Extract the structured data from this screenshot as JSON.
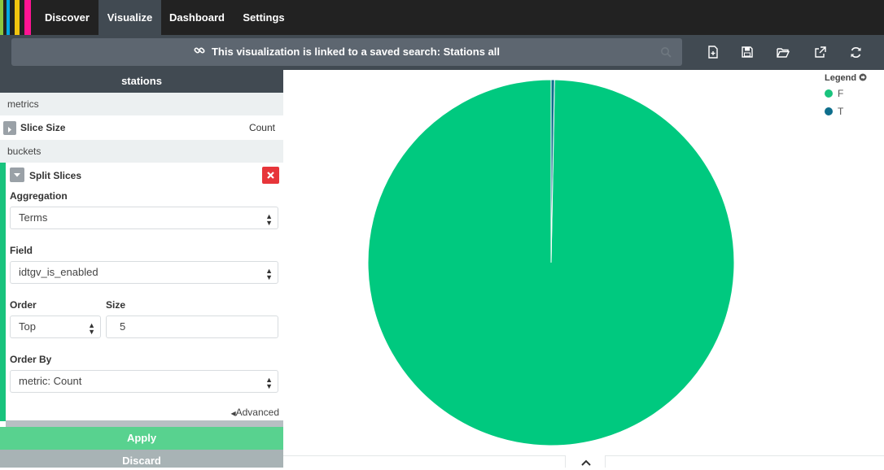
{
  "nav": {
    "tabs": [
      {
        "label": "Discover"
      },
      {
        "label": "Visualize"
      },
      {
        "label": "Dashboard"
      },
      {
        "label": "Settings"
      }
    ],
    "logo_colors": [
      "#f1c40f",
      "#00a9e5",
      "#8cc63f",
      "#ff1493",
      "#e8488b"
    ]
  },
  "toolbar": {
    "message_prefix": "This visualization is linked to a saved search: ",
    "message_search": "Stations all"
  },
  "sidebar": {
    "title": "stations",
    "metrics_label": "metrics",
    "metric": {
      "name": "Slice Size",
      "value": "Count"
    },
    "buckets_label": "buckets",
    "bucket_title": "Split Slices",
    "aggregation_label": "Aggregation",
    "aggregation_value": "Terms",
    "field_label": "Field",
    "field_value": "idtgv_is_enabled",
    "order_label": "Order",
    "order_value": "Top",
    "size_label": "Size",
    "size_value": "5",
    "order_by_label": "Order By",
    "order_by_value": "metric: Count",
    "advanced_label": "Advanced",
    "apply_label": "Apply",
    "discard_label": "Discard"
  },
  "legend": {
    "title": "Legend",
    "items": [
      {
        "label": "F",
        "color": "#19c37d"
      },
      {
        "label": "T",
        "color": "#0e6e8c"
      }
    ]
  },
  "chart_data": {
    "type": "pie",
    "categories": [
      "F",
      "T"
    ],
    "values": [
      99.7,
      0.3
    ],
    "colors": [
      "#00c97f",
      "#0e6e8c"
    ]
  }
}
